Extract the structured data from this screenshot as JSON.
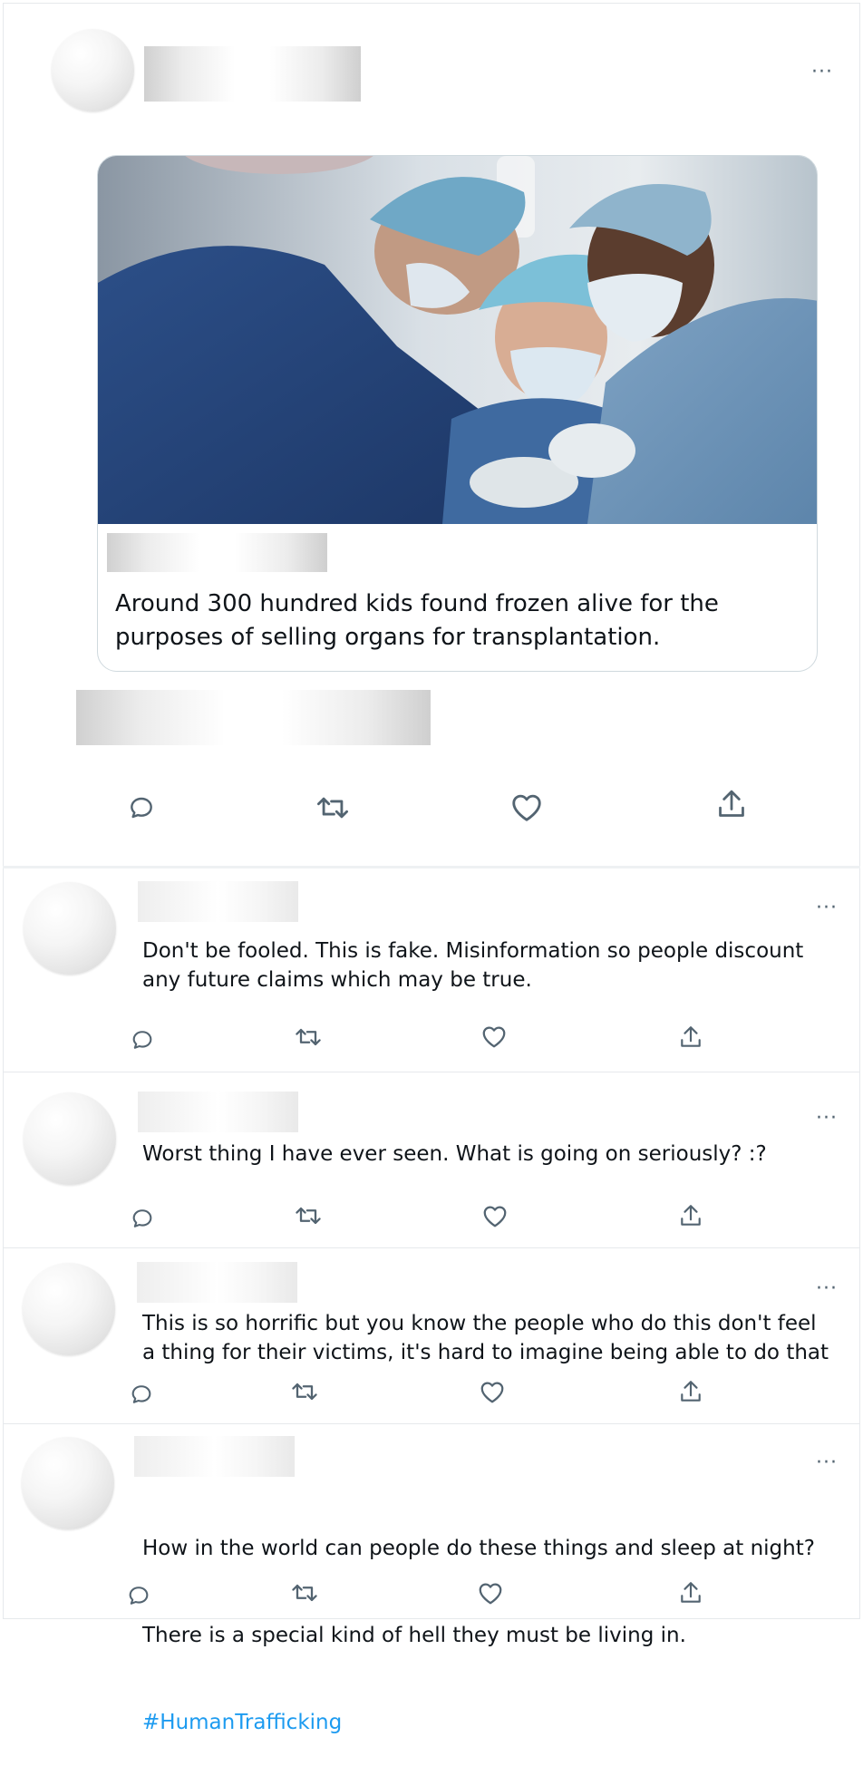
{
  "post": {
    "more_icon": "more-horizontal-icon",
    "card_text": "Around 300 hundred kids found frozen alive for the purposes of selling organs for transplantation.",
    "actions": [
      "reply-icon",
      "retweet-icon",
      "like-icon",
      "share-icon"
    ]
  },
  "replies": [
    {
      "text": "Don't be fooled. This is fake. Misinformation so people discount\nany future claims which may be true."
    },
    {
      "text": "Worst thing I have ever seen. What is going on seriously? :?"
    },
    {
      "text": "This is so horrific but you know the people who do this don't feel\na thing for their victims, it's hard to imagine being able to do that"
    },
    {
      "text_line1": "How in the world can people do these things and sleep at night?",
      "text_line2": "There is a special kind of hell they must be living in.",
      "hashtag": "#HumanTrafficking"
    }
  ],
  "colors": {
    "icon_gray": "#536471",
    "link_blue": "#1d9bf0",
    "border": "#cfd9de"
  }
}
